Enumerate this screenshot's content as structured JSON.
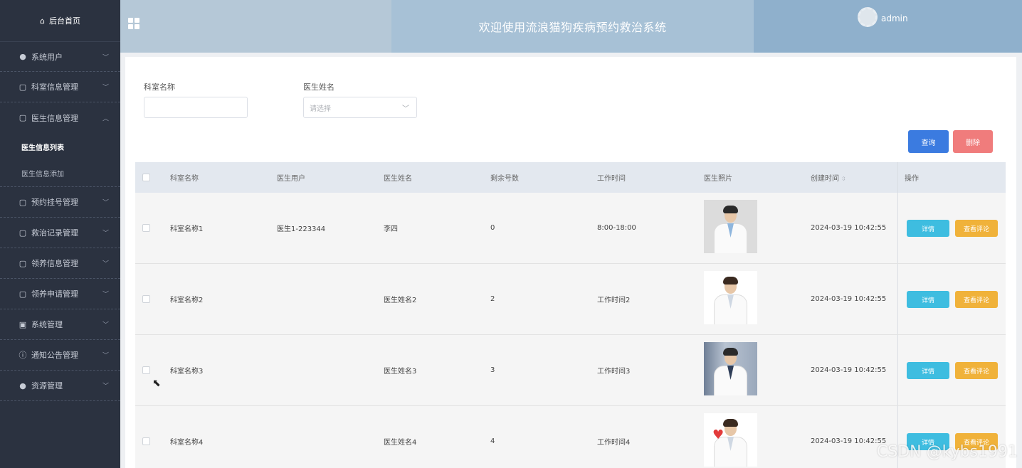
{
  "sidebar": {
    "home": "后台首页",
    "items": [
      {
        "label": "系统用户",
        "icon": "user-icon",
        "expanded": false
      },
      {
        "label": "科室信息管理",
        "icon": "folder-icon",
        "expanded": false
      },
      {
        "label": "医生信息管理",
        "icon": "folder-icon",
        "expanded": true,
        "children": [
          "医生信息列表",
          "医生信息添加"
        ]
      },
      {
        "label": "预约挂号管理",
        "icon": "folder-icon",
        "expanded": false
      },
      {
        "label": "救治记录管理",
        "icon": "folder-icon",
        "expanded": false
      },
      {
        "label": "领养信息管理",
        "icon": "folder-icon",
        "expanded": false
      },
      {
        "label": "领养申请管理",
        "icon": "folder-icon",
        "expanded": false
      },
      {
        "label": "系统管理",
        "icon": "picture-icon",
        "expanded": false
      },
      {
        "label": "通知公告管理",
        "icon": "info-icon",
        "expanded": false
      },
      {
        "label": "资源管理",
        "icon": "location-icon",
        "expanded": false
      }
    ]
  },
  "header": {
    "title": "欢迎使用流浪猫狗疾病预约救治系统",
    "username": "admin"
  },
  "filters": {
    "dept_label": "科室名称",
    "dept_value": "",
    "doctor_label": "医生姓名",
    "doctor_placeholder": "请选择"
  },
  "buttons": {
    "query": "查询",
    "delete": "删除"
  },
  "table": {
    "headers": [
      "科室名称",
      "医生用户",
      "医生姓名",
      "剩余号数",
      "工作时间",
      "医生照片",
      "创建时间",
      "操作"
    ],
    "rows": [
      {
        "dept": "科室名称1",
        "user": "医生1-223344",
        "name": "李四",
        "remaining": "0",
        "time": "8:00-18:00",
        "created": "2024-03-19 10:42:55",
        "photo": "doctor-male-1"
      },
      {
        "dept": "科室名称2",
        "user": "",
        "name": "医生姓名2",
        "remaining": "2",
        "time": "工作时间2",
        "created": "2024-03-19 10:42:55",
        "photo": "doctor-female-1"
      },
      {
        "dept": "科室名称3",
        "user": "",
        "name": "医生姓名3",
        "remaining": "3",
        "time": "工作时间3",
        "created": "2024-03-19 10:42:55",
        "photo": "doctor-male-2"
      },
      {
        "dept": "科室名称4",
        "user": "",
        "name": "医生姓名4",
        "remaining": "4",
        "time": "工作时间4",
        "created": "2024-03-19 10:42:55",
        "photo": "doctor-female-2"
      }
    ],
    "actions": {
      "detail": "详情",
      "review": "查看评论"
    }
  },
  "watermark": "CSDN @kybs1991"
}
